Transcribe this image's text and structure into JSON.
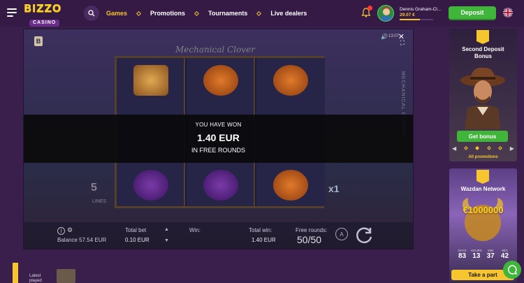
{
  "header": {
    "logo_top": "BIZZO",
    "logo_bottom": "CASINO",
    "nav": [
      {
        "label": "Games",
        "active": true
      },
      {
        "label": "Promotions",
        "active": false
      },
      {
        "label": "Tournaments",
        "active": false
      },
      {
        "label": "Live dealers",
        "active": false
      }
    ],
    "user": {
      "name": "Dennis Graham-Cl...",
      "balance": "29.07 €"
    },
    "deposit_label": "Deposit",
    "accent_color": "#f7c52e",
    "cta_color": "#3fb53a"
  },
  "game": {
    "title": "Mechanical Clover",
    "side_title": "MECHANICAL CLOVER",
    "time": "13:07",
    "brand_letter": "B",
    "lines_number": "5",
    "lines_label": "LINES",
    "multiplier": "x1",
    "win": {
      "line1": "YOU HAVE WON",
      "amount": "1.40 EUR",
      "line3": "IN FREE ROUNDS"
    },
    "bottom": {
      "balance": "Balance 57.54 EUR",
      "total_bet_label": "Total bet",
      "total_bet_value": "0.10 EUR",
      "win_label": "Win:",
      "total_win_label": "Total win:",
      "total_win_value": "1.40 EUR",
      "free_rounds_label": "Free rounds:",
      "free_rounds_value": "50/50",
      "auto_label": "A"
    }
  },
  "sidebar": {
    "promo1": {
      "title_line1": "Second Deposit",
      "title_line2": "Bonus",
      "button": "Get bonus",
      "all_promos": "All promotions"
    },
    "promo2": {
      "title": "Wazdan Network",
      "prize": "€1000000",
      "countdown": [
        {
          "label": "DAYS",
          "value": "83"
        },
        {
          "label": "HOURS",
          "value": "13"
        },
        {
          "label": "MIN",
          "value": "37"
        },
        {
          "label": "SEC",
          "value": "42"
        }
      ],
      "button": "Take a part"
    }
  },
  "latest": {
    "line1": "Latest",
    "line2": "played"
  }
}
